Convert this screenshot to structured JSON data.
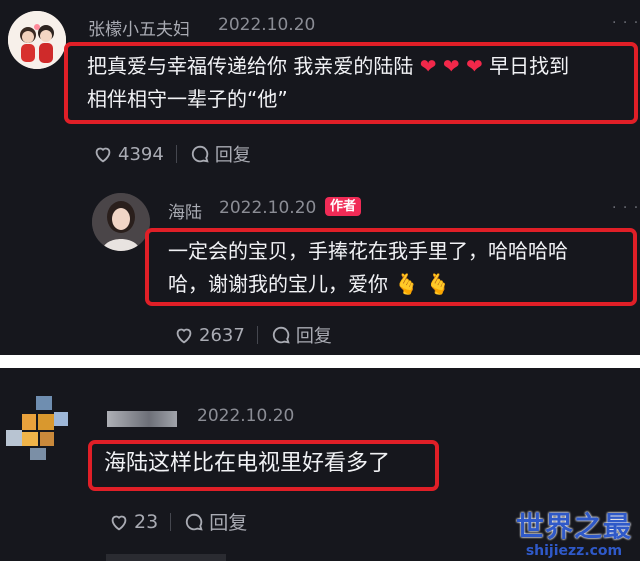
{
  "comments": [
    {
      "username": "张檬小五夫妇",
      "date": "2022.10.20",
      "text_line1": "把真爱与幸福传递给你 我亲爱的陆陆",
      "hearts": "❤ ❤ ❤",
      "text_line1_end": "早日找到",
      "text_line2": "相伴相守一辈子的“他”",
      "likes": "4394",
      "reply_label": "回复"
    },
    {
      "username": "海陆",
      "date": "2022.10.20",
      "badge": "作者",
      "text_line1": "一定会的宝贝，手捧花在我手里了，哈哈哈哈",
      "text_line2": "哈，谢谢我的宝儿，爱你",
      "kisses": "🫰 🫰",
      "likes": "2637",
      "reply_label": "回复"
    },
    {
      "date": "2022.10.20",
      "text": "海陆这样比在电视里好看多了",
      "likes": "23",
      "reply_label": "回复"
    }
  ],
  "more_icon": "ellipsis-icon",
  "watermark": {
    "title": "世界之最",
    "url": "shijiezz.com"
  },
  "colors": {
    "highlight": "#e01f27",
    "badge": "#f02b56",
    "heart": "#f2284a",
    "watermark": "#2f59c8"
  }
}
